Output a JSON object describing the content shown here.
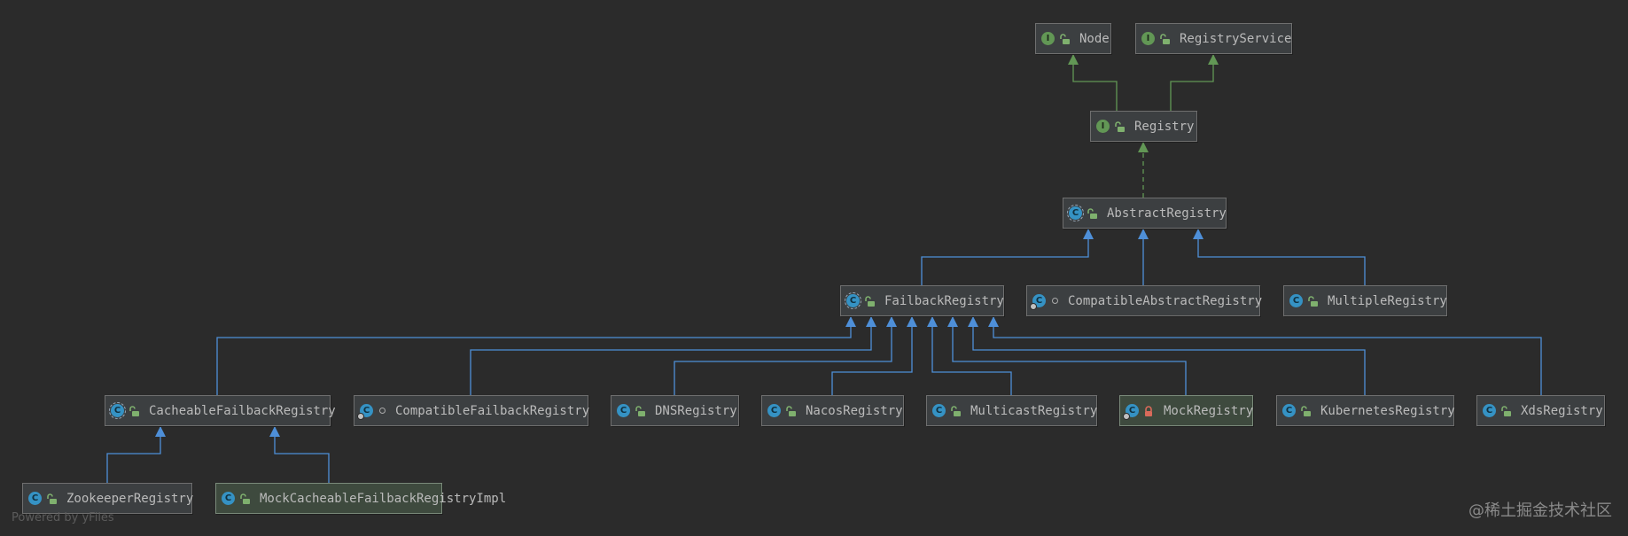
{
  "nodes": [
    {
      "id": "node",
      "label": "Node",
      "kind": "iface",
      "vis": "open"
    },
    {
      "id": "registry-service",
      "label": "RegistryService",
      "kind": "iface",
      "vis": "open"
    },
    {
      "id": "registry",
      "label": "Registry",
      "kind": "iface",
      "vis": "open"
    },
    {
      "id": "abstract-registry",
      "label": "AbstractRegistry",
      "kind": "abstract",
      "vis": "open"
    },
    {
      "id": "failback-registry",
      "label": "FailbackRegistry",
      "kind": "abstract",
      "vis": "open"
    },
    {
      "id": "compatible-abstract-registry",
      "label": "CompatibleAbstractRegistry",
      "kind": "cls",
      "vis": "pkg"
    },
    {
      "id": "multiple-registry",
      "label": "MultipleRegistry",
      "kind": "cls",
      "vis": "open"
    },
    {
      "id": "cacheable-failback-registry",
      "label": "CacheableFailbackRegistry",
      "kind": "abstract",
      "vis": "open"
    },
    {
      "id": "compatible-failback-registry",
      "label": "CompatibleFailbackRegistry",
      "kind": "cls",
      "vis": "pkg"
    },
    {
      "id": "dns-registry",
      "label": "DNSRegistry",
      "kind": "cls",
      "vis": "open"
    },
    {
      "id": "nacos-registry",
      "label": "NacosRegistry",
      "kind": "cls",
      "vis": "open"
    },
    {
      "id": "multicast-registry",
      "label": "MulticastRegistry",
      "kind": "cls",
      "vis": "open"
    },
    {
      "id": "mock-registry",
      "label": "MockRegistry",
      "kind": "cls",
      "vis": "lock",
      "highlight": true
    },
    {
      "id": "kubernetes-registry",
      "label": "KubernetesRegistry",
      "kind": "cls",
      "vis": "open"
    },
    {
      "id": "xds-registry",
      "label": "XdsRegistry",
      "kind": "cls",
      "vis": "open"
    },
    {
      "id": "zookeeper-registry",
      "label": "ZookeeperRegistry",
      "kind": "cls",
      "vis": "open"
    },
    {
      "id": "mock-cacheable-failback-registry-impl",
      "label": "MockCacheableFailbackRegistryImpl",
      "kind": "cls",
      "vis": "open",
      "highlight": true
    }
  ],
  "edges": [
    {
      "from": "registry",
      "to": "node",
      "type": "extends-interface"
    },
    {
      "from": "registry",
      "to": "registry-service",
      "type": "extends-interface"
    },
    {
      "from": "abstract-registry",
      "to": "registry",
      "type": "implements"
    },
    {
      "from": "failback-registry",
      "to": "abstract-registry",
      "type": "extends"
    },
    {
      "from": "compatible-abstract-registry",
      "to": "abstract-registry",
      "type": "extends"
    },
    {
      "from": "multiple-registry",
      "to": "abstract-registry",
      "type": "extends"
    },
    {
      "from": "cacheable-failback-registry",
      "to": "failback-registry",
      "type": "extends"
    },
    {
      "from": "compatible-failback-registry",
      "to": "failback-registry",
      "type": "extends"
    },
    {
      "from": "dns-registry",
      "to": "failback-registry",
      "type": "extends"
    },
    {
      "from": "nacos-registry",
      "to": "failback-registry",
      "type": "extends"
    },
    {
      "from": "multicast-registry",
      "to": "failback-registry",
      "type": "extends"
    },
    {
      "from": "mock-registry",
      "to": "failback-registry",
      "type": "extends"
    },
    {
      "from": "kubernetes-registry",
      "to": "failback-registry",
      "type": "extends"
    },
    {
      "from": "xds-registry",
      "to": "failback-registry",
      "type": "extends"
    },
    {
      "from": "zookeeper-registry",
      "to": "cacheable-failback-registry",
      "type": "extends"
    },
    {
      "from": "mock-cacheable-failback-registry-impl",
      "to": "cacheable-failback-registry",
      "type": "extends"
    }
  ],
  "colors": {
    "background": "#2b2b2b",
    "interface_edge": "#629755",
    "class_edge": "#4e8fd8",
    "interface_badge": "#629755",
    "class_badge": "#3592c4"
  },
  "footer": {
    "powered_by": "Powered by yFiles",
    "watermark": "@稀土掘金技术社区"
  }
}
